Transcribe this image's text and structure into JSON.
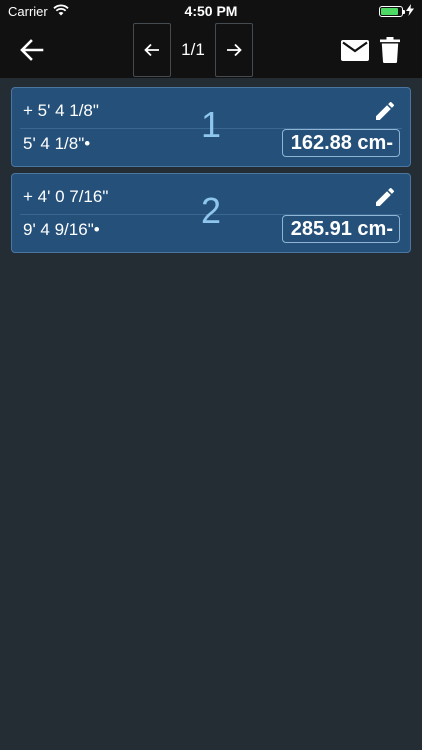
{
  "status_bar": {
    "carrier": "Carrier",
    "time": "4:50 PM",
    "battery_level": 0.85,
    "battery_color": "#4cd964"
  },
  "toolbar": {
    "back_icon": "arrow-left-icon",
    "prev_icon": "arrow-left-icon",
    "page_label": "1/1",
    "next_icon": "arrow-right-icon",
    "mail_icon": "mail-icon",
    "trash_icon": "trash-icon"
  },
  "entries": [
    {
      "increment": "+ 5' 4 1/8\"",
      "total": "5' 4 1/8\"•",
      "index": "1",
      "metric": "162.88 cm-"
    },
    {
      "increment": "+ 4' 0 7/16\"",
      "total": "9' 4 9/16\"•",
      "index": "2",
      "metric": "285.91 cm-"
    }
  ],
  "colors": {
    "background": "#232d33",
    "bar": "#111111",
    "card": "#24507a",
    "card_border": "#4a76a0",
    "index_text": "#8ec6ee"
  }
}
